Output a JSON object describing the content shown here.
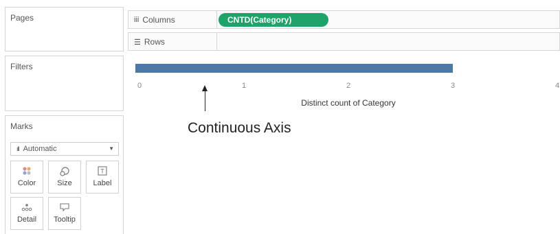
{
  "pages": {
    "title": "Pages"
  },
  "filters": {
    "title": "Filters"
  },
  "marks": {
    "title": "Marks",
    "type_select": "Automatic",
    "type_icon": "bar-chart-icon",
    "buttons": [
      {
        "label": "Color",
        "icon": "color-icon"
      },
      {
        "label": "Size",
        "icon": "size-icon"
      },
      {
        "label": "Label",
        "icon": "label-icon"
      },
      {
        "label": "Detail",
        "icon": "detail-icon"
      },
      {
        "label": "Tooltip",
        "icon": "tooltip-icon"
      }
    ]
  },
  "columns_shelf": {
    "label": "Columns",
    "icon": "columns-icon",
    "pill": "CNTD(Category)"
  },
  "rows_shelf": {
    "label": "Rows",
    "icon": "rows-icon"
  },
  "colors": {
    "pill": "#1ea36a",
    "bar": "#4e79a7"
  },
  "annotation": {
    "text": "Continuous Axis"
  },
  "chart_data": {
    "type": "bar",
    "orientation": "horizontal",
    "categories": [
      ""
    ],
    "values": [
      3
    ],
    "xlabel": "Distinct count of Category",
    "ylabel": "",
    "xlim": [
      0,
      4
    ],
    "ticks": [
      "0",
      "1",
      "2",
      "3",
      "4"
    ],
    "grid": false
  }
}
